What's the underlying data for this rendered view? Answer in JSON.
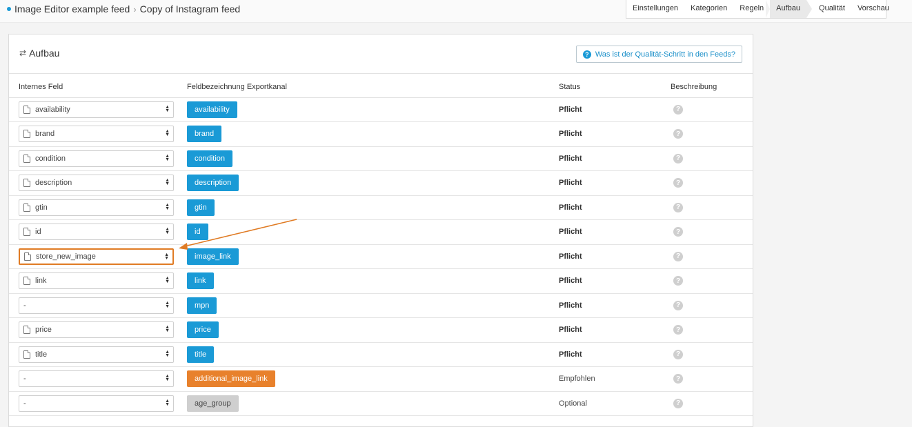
{
  "breadcrumb": {
    "first": "Image Editor example feed",
    "second": "Copy of Instagram feed"
  },
  "steps": [
    "Einstellungen",
    "Kategorien",
    "Regeln",
    "Aufbau",
    "Qualität",
    "Vorschau"
  ],
  "active_step": "Aufbau",
  "panel": {
    "title": "Aufbau",
    "help_button": "Was ist der Qualität-Schritt in den Feeds?"
  },
  "columns": {
    "internal": "Internes Feld",
    "export": "Feldbezeichnung Exportkanal",
    "status": "Status",
    "description": "Beschreibung"
  },
  "rows": [
    {
      "internal": "availability",
      "has_icon": true,
      "export": "availability",
      "kind": "required",
      "status": "Pflicht"
    },
    {
      "internal": "brand",
      "has_icon": true,
      "export": "brand",
      "kind": "required",
      "status": "Pflicht"
    },
    {
      "internal": "condition",
      "has_icon": true,
      "export": "condition",
      "kind": "required",
      "status": "Pflicht"
    },
    {
      "internal": "description",
      "has_icon": true,
      "export": "description",
      "kind": "required",
      "status": "Pflicht"
    },
    {
      "internal": "gtin",
      "has_icon": true,
      "export": "gtin",
      "kind": "required",
      "status": "Pflicht"
    },
    {
      "internal": "id",
      "has_icon": true,
      "export": "id",
      "kind": "required",
      "status": "Pflicht"
    },
    {
      "internal": "store_new_image",
      "has_icon": true,
      "export": "image_link",
      "kind": "required",
      "status": "Pflicht",
      "highlight": true
    },
    {
      "internal": "link",
      "has_icon": true,
      "export": "link",
      "kind": "required",
      "status": "Pflicht"
    },
    {
      "internal": "-",
      "has_icon": false,
      "export": "mpn",
      "kind": "required",
      "status": "Pflicht"
    },
    {
      "internal": "price",
      "has_icon": true,
      "export": "price",
      "kind": "required",
      "status": "Pflicht"
    },
    {
      "internal": "title",
      "has_icon": true,
      "export": "title",
      "kind": "required",
      "status": "Pflicht"
    },
    {
      "internal": "-",
      "has_icon": false,
      "export": "additional_image_link",
      "kind": "recommended",
      "status": "Empfohlen"
    },
    {
      "internal": "-",
      "has_icon": false,
      "export": "age_group",
      "kind": "optional",
      "status": "Optional"
    }
  ],
  "colors": {
    "accent": "#1a9ad6",
    "recommended": "#e8812c",
    "optional": "#cfcfcf",
    "annotation": "#e07b24"
  },
  "annotation": {
    "type": "arrow",
    "target": "store_new_image"
  }
}
